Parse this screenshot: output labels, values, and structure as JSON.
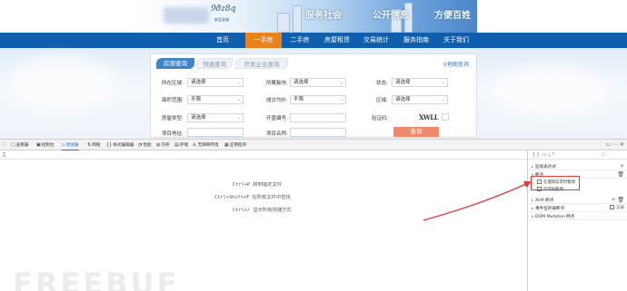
{
  "banner": {
    "logo_text": "9ðz8q",
    "logo_sub": "新会县城",
    "slogans": [
      "服务社会",
      "公开信息",
      "方便百姓"
    ]
  },
  "nav": {
    "items": [
      "首页",
      "一手房",
      "二手房",
      "房屋租赁",
      "交易统计",
      "服务指南",
      "关于我们"
    ],
    "active_index": 1,
    "active_color": "#e9831d",
    "bar_color": "#0f5fae"
  },
  "search": {
    "tabs": [
      "房源查询",
      "快速查询",
      "开发企业查询"
    ],
    "map_link": "地图查询",
    "fields": {
      "region": {
        "label": "所在区域:",
        "value": "请选择"
      },
      "block": {
        "label": "所属板块:",
        "value": "请选择"
      },
      "status": {
        "label": "状态:",
        "value": "请选择"
      },
      "area": {
        "label": "面积范围:",
        "value": "不限"
      },
      "avg_price": {
        "label": "成交均价:",
        "value": "不限"
      },
      "zone": {
        "label": "区域:",
        "value": "请选择"
      },
      "house_type": {
        "label": "房屋类型:",
        "value": "请选择"
      },
      "permit_no": {
        "label": "开盘编号:",
        "value": ""
      },
      "captcha": {
        "label": "验证码:",
        "value": ""
      },
      "project_addr": {
        "label": "项目地址:",
        "value": ""
      },
      "project_name": {
        "label": "项目名称:",
        "value": ""
      }
    },
    "captcha_text": "XWLL",
    "submit": "查询",
    "submit_color": "#f08a6d"
  },
  "devtools": {
    "tabs": [
      "查看器",
      "控制台",
      "调试器",
      "网络",
      "样式编辑器",
      "性能",
      "内存",
      "存储",
      "无障碍环境",
      "应用程序"
    ],
    "active_tab_index": 2,
    "hints": [
      "Ctrl+P 转到指定文件",
      "Ctrl+Shift+F 在所有文件中查找",
      "Ctrl+/ 显示所有快捷方式"
    ],
    "side": {
      "sections": {
        "watch": "监视表达式",
        "breakpoints": "断点",
        "xhr": "XHR 断点",
        "event_listener": "事件监听器断点",
        "dom_mutation": "DOM Mutation 断点"
      },
      "checkboxes": [
        "在遇到异常时暂停",
        "异常处暂停"
      ],
      "log_label": "记录"
    },
    "watermark": "FREEBUF"
  }
}
